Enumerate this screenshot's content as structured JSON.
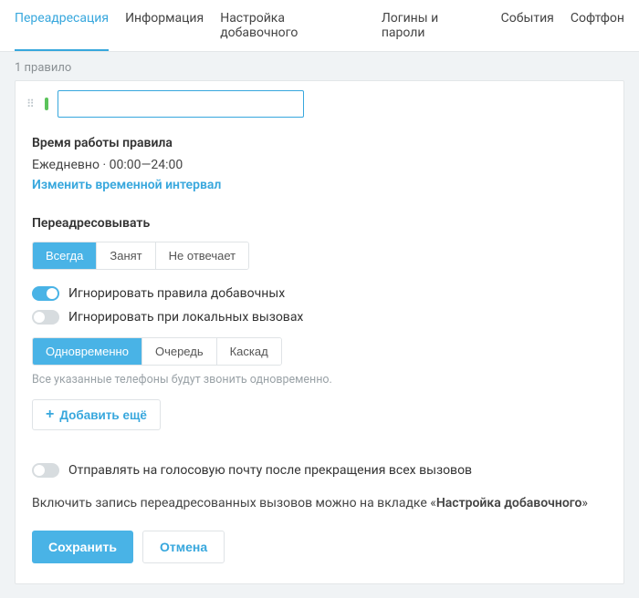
{
  "tabs": {
    "items": [
      {
        "label": "Переадресация",
        "active": true
      },
      {
        "label": "Информация",
        "active": false
      },
      {
        "label": "Настройка добавочного",
        "active": false
      },
      {
        "label": "Логины и пароли",
        "active": false
      },
      {
        "label": "События",
        "active": false
      },
      {
        "label": "Софтфон",
        "active": false
      }
    ]
  },
  "rules_count": "1 правило",
  "rule": {
    "name_value": "",
    "schedule": {
      "heading": "Время работы правила",
      "summary": "Ежедневно · 00:00—24:00",
      "change_link": "Изменить временной интервал"
    },
    "forward": {
      "heading": "Переадресовывать",
      "modes": [
        {
          "label": "Всегда",
          "active": true
        },
        {
          "label": "Занят",
          "active": false
        },
        {
          "label": "Не отвечает",
          "active": false
        }
      ],
      "ignore_ext_rules": {
        "label": "Игнорировать правила добавочных",
        "on": true
      },
      "ignore_local": {
        "label": "Игнорировать при локальных вызовах",
        "on": false
      },
      "strategy": [
        {
          "label": "Одновременно",
          "active": true
        },
        {
          "label": "Очередь",
          "active": false
        },
        {
          "label": "Каскад",
          "active": false
        }
      ],
      "strategy_hint": "Все указанные телефоны будут звонить одновременно.",
      "add_more": "Добавить ещё"
    },
    "voicemail": {
      "label": "Отправлять на голосовую почту после прекращения всех вызовов",
      "on": false
    },
    "recording_note_prefix": "Включить запись переадресованных вызовов можно на вкладке «",
    "recording_note_tab": "Настройка добавочного",
    "recording_note_suffix": "»"
  },
  "actions": {
    "save": "Сохранить",
    "cancel": "Отмена"
  }
}
